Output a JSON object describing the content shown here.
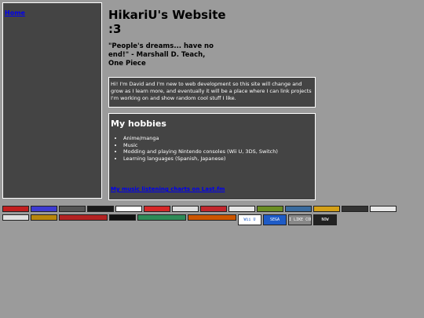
{
  "sidebar": {
    "home_link": "Home"
  },
  "header": {
    "title": "HikariU's Website :3"
  },
  "quote": {
    "text": "\"People's dreams... have no end!\" - Marshall D. Teach, One Piece"
  },
  "intro": {
    "text": "Hi! I'm David and I'm new to web development so this site will change and grow as I learn more, and eventually it will be a place where I can link projects I'm working on and show random cool stuff I like."
  },
  "hobbies": {
    "heading": "My hobbies",
    "items": [
      "Anime/manga",
      "Music",
      "Modding and playing Nintendo consoles (Wii U, 3DS, Switch)",
      "Learning languages (Spanish, Japanese)"
    ],
    "link": "My music listening charts on Last.fm"
  },
  "badges": {
    "row1": [
      {
        "label": "",
        "color": "#c21f1f"
      },
      {
        "label": "",
        "color": "#3d3bd1"
      },
      {
        "label": "",
        "color": "#555555"
      },
      {
        "label": "",
        "color": "#1a1a1a"
      },
      {
        "label": "",
        "color": "#ffffff"
      },
      {
        "label": "",
        "color": "#d62828"
      },
      {
        "label": "",
        "color": "#e0e0e0"
      },
      {
        "label": "",
        "color": "#c2272d"
      },
      {
        "label": "",
        "color": "#e7e7e7"
      },
      {
        "label": "",
        "color": "#6b8e23"
      },
      {
        "label": "",
        "color": "#3a6b9e"
      },
      {
        "label": "",
        "color": "#d4a017"
      },
      {
        "label": "",
        "color": "#333333"
      },
      {
        "label": "",
        "color": "#e8e8e8"
      }
    ],
    "row2": [
      {
        "label": "",
        "color": "#e0e0e0"
      },
      {
        "label": "",
        "color": "#b8860b"
      },
      {
        "label": "",
        "color": "#b22222",
        "wide": true
      },
      {
        "label": "",
        "color": "#111111"
      },
      {
        "label": "",
        "color": "#2e8b57",
        "wide": true
      },
      {
        "label": "",
        "color": "#cc5500",
        "wide": true
      },
      {
        "label": "Wii U",
        "color": "#ffffff",
        "big": true
      },
      {
        "label": "SEGA",
        "color": "#1e5bc6",
        "big": true
      },
      {
        "label": "I LIKE COMPUTER",
        "color": "#888888",
        "big": true
      },
      {
        "label": "NOW",
        "color": "#222222",
        "big": true
      }
    ]
  }
}
